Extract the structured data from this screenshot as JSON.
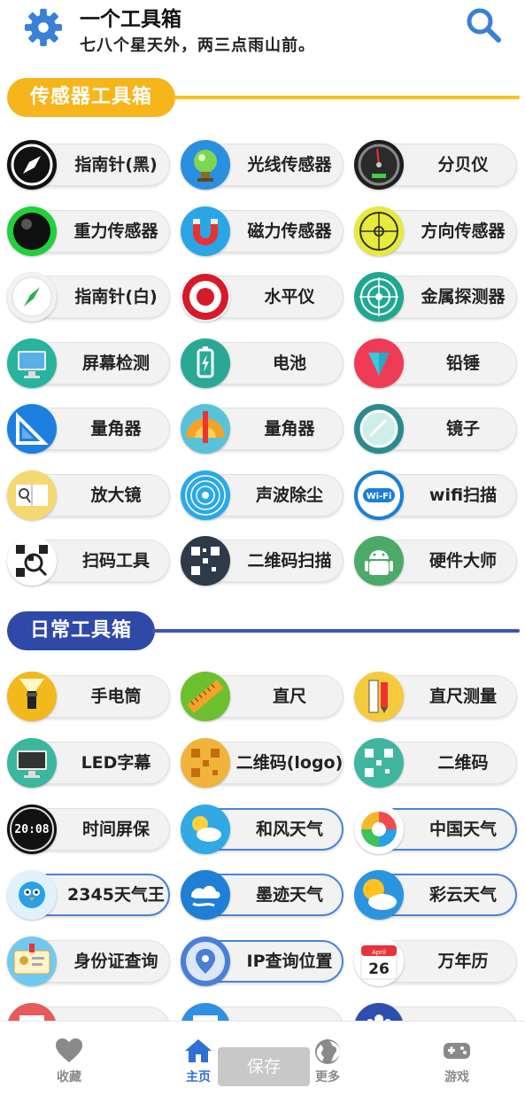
{
  "header": {
    "title": "一个工具箱",
    "subtitle": "七八个星天外，两三点雨山前。",
    "settings_icon": "gear-icon",
    "search_icon": "search-icon"
  },
  "colors": {
    "sensor_section": "#f7b51c",
    "daily_section": "#2e49a8",
    "accent_blue": "#2f6fd6"
  },
  "sections": {
    "sensor": {
      "title": "传感器工具箱"
    },
    "daily": {
      "title": "日常工具箱"
    }
  },
  "sensor_tools": [
    {
      "label": "指南针(黑)",
      "icon": "compass-black-icon"
    },
    {
      "label": "光线传感器",
      "icon": "light-bulb-icon"
    },
    {
      "label": "分贝仪",
      "icon": "gauge-icon"
    },
    {
      "label": "重力传感器",
      "icon": "ball-icon"
    },
    {
      "label": "磁力传感器",
      "icon": "magnet-icon"
    },
    {
      "label": "方向传感器",
      "icon": "direction-level-icon"
    },
    {
      "label": "指南针(白)",
      "icon": "compass-white-icon"
    },
    {
      "label": "水平仪",
      "icon": "target-icon"
    },
    {
      "label": "金属探测器",
      "icon": "radar-icon"
    },
    {
      "label": "屏幕检测",
      "icon": "monitor-icon"
    },
    {
      "label": "电池",
      "icon": "battery-icon"
    },
    {
      "label": "铅锤",
      "icon": "plumb-icon"
    },
    {
      "label": "量角器",
      "icon": "set-square-icon"
    },
    {
      "label": "量角器",
      "icon": "protractor-icon"
    },
    {
      "label": "镜子",
      "icon": "mirror-icon"
    },
    {
      "label": "放大镜",
      "icon": "magnifier-book-icon"
    },
    {
      "label": "声波除尘",
      "icon": "sound-wave-icon"
    },
    {
      "label": "wifi扫描",
      "icon": "wifi-icon"
    },
    {
      "label": "扫码工具",
      "icon": "qr-scan-icon"
    },
    {
      "label": "二维码扫描",
      "icon": "qr-code-icon"
    },
    {
      "label": "硬件大师",
      "icon": "android-icon"
    }
  ],
  "daily_tools": [
    {
      "label": "手电筒",
      "icon": "flashlight-icon"
    },
    {
      "label": "直尺",
      "icon": "ruler-icon"
    },
    {
      "label": "直尺测量",
      "icon": "ruler-pencil-icon"
    },
    {
      "label": "LED字幕",
      "icon": "led-screen-icon"
    },
    {
      "label": "二维码(logo)",
      "icon": "qr-logo-icon"
    },
    {
      "label": "二维码",
      "icon": "qr-icon"
    },
    {
      "label": "时间屏保",
      "icon": "digital-clock-icon"
    },
    {
      "label": "和风天气",
      "icon": "sun-cloud-icon"
    },
    {
      "label": "中国天气",
      "icon": "swirl-icon"
    },
    {
      "label": "2345天气王",
      "icon": "bird-icon"
    },
    {
      "label": "墨迹天气",
      "icon": "cloud-wind-icon"
    },
    {
      "label": "彩云天气",
      "icon": "cloud-sun-icon"
    },
    {
      "label": "身份证查询",
      "icon": "id-card-icon"
    },
    {
      "label": "IP查询位置",
      "icon": "location-pin-icon"
    },
    {
      "label": "万年历",
      "icon": "calendar-icon"
    },
    {
      "label": "",
      "icon": "partial-icon-1"
    },
    {
      "label": "",
      "icon": "partial-icon-2"
    },
    {
      "label": "",
      "icon": "partial-icon-3"
    }
  ],
  "calendar_day": "26",
  "calendar_month": "April",
  "clock_text": "20:08",
  "bottom_nav": {
    "favorites": {
      "label": "收藏",
      "icon": "heart-icon"
    },
    "home": {
      "label": "主页",
      "icon": "home-icon"
    },
    "more": {
      "label": "更多",
      "icon": "globe-icon"
    },
    "games": {
      "label": "游戏",
      "icon": "gamepad-icon"
    },
    "save_button": "保存"
  }
}
